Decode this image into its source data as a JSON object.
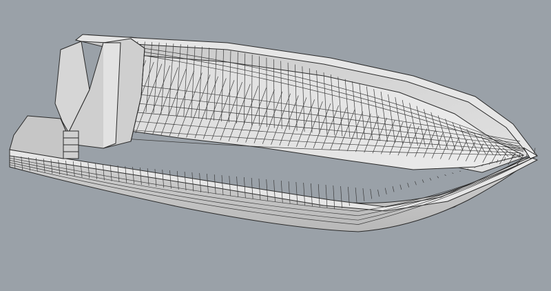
{
  "viewport": {
    "background_color": "#9aa1a8",
    "display_mode": "shaded-wireframe",
    "surface_color": "#dcdcdc",
    "wire_color": "#2a2a2a"
  },
  "model": {
    "object": "boat-hull",
    "parts": [
      "hull-exterior",
      "hull-interior",
      "deck-floor",
      "gunwale",
      "console-bench",
      "transom-box",
      "bow-tip"
    ]
  }
}
